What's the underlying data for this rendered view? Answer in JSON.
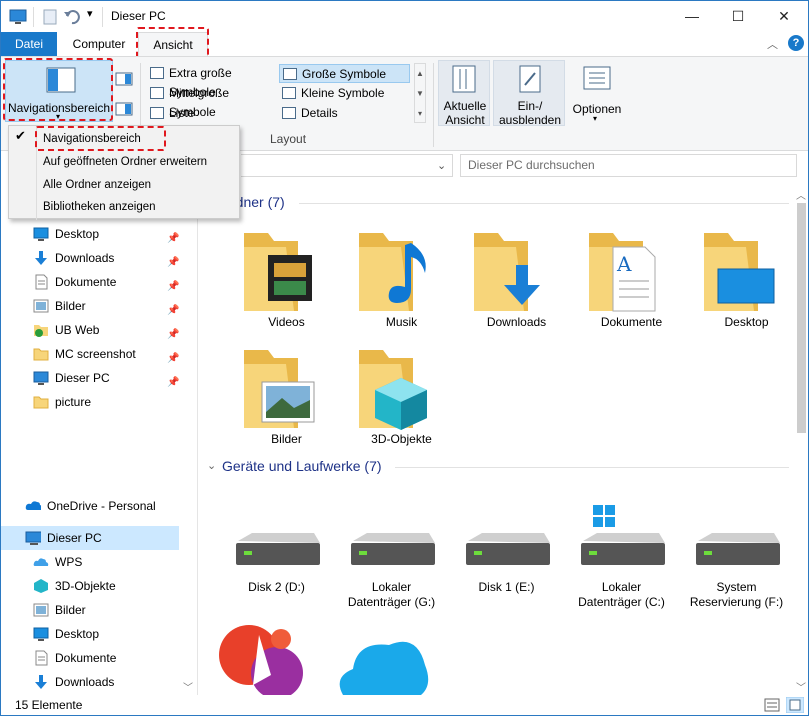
{
  "title": "Dieser PC",
  "tabs": {
    "file": "Datei",
    "computer": "Computer",
    "view": "Ansicht"
  },
  "ribbon": {
    "nav_pane": "Navigationsbereich",
    "layout": {
      "items": [
        "Extra große Symbole",
        "Große Symbole",
        "Mittelgroße Symbole",
        "Kleine Symbole",
        "Liste",
        "Details"
      ],
      "group_label": "Layout"
    },
    "current_view": [
      "Aktuelle",
      "Ansicht"
    ],
    "show_hide": [
      "Ein-/",
      "ausblenden"
    ],
    "options": "Optionen"
  },
  "dropdown": {
    "items": [
      "Navigationsbereich",
      "Auf geöffneten Ordner erweitern",
      "Alle Ordner anzeigen",
      "Bibliotheken anzeigen"
    ]
  },
  "search": {
    "placeholder": "Dieser PC durchsuchen"
  },
  "nav": {
    "quick": [
      {
        "label": "Desktop",
        "icon": "desktop-icon"
      },
      {
        "label": "Downloads",
        "icon": "download-icon"
      },
      {
        "label": "Dokumente",
        "icon": "documents-icon"
      },
      {
        "label": "Bilder",
        "icon": "pictures-icon"
      },
      {
        "label": "UB Web",
        "icon": "folder-check-icon"
      },
      {
        "label": "MC screenshot",
        "icon": "folder-icon"
      },
      {
        "label": "Dieser PC",
        "icon": "pc-icon"
      },
      {
        "label": "picture",
        "icon": "folder-icon"
      }
    ],
    "onedrive": "OneDrive - Personal",
    "thispc": "Dieser PC",
    "thispc_items": [
      "WPS",
      "3D-Objekte",
      "Bilder",
      "Desktop",
      "Dokumente",
      "Downloads"
    ]
  },
  "content": {
    "folders_header": "rdner (7)",
    "folders": [
      "Videos",
      "Musik",
      "Downloads",
      "Dokumente",
      "Desktop",
      "Bilder",
      "3D-Objekte"
    ],
    "drives_header": "Geräte und Laufwerke (7)",
    "drives": [
      [
        "Disk 2 (D:)",
        ""
      ],
      [
        "Lokaler",
        "Datenträger (G:)"
      ],
      [
        "Disk 1 (E:)",
        ""
      ],
      [
        "Lokaler",
        "Datenträger (C:)"
      ],
      [
        "System",
        "Reservierung (F:)"
      ]
    ]
  },
  "status": "15 Elemente",
  "colors": {
    "accent": "#1979ca",
    "highlight": "#e0181e",
    "selection": "#cce8ff"
  }
}
